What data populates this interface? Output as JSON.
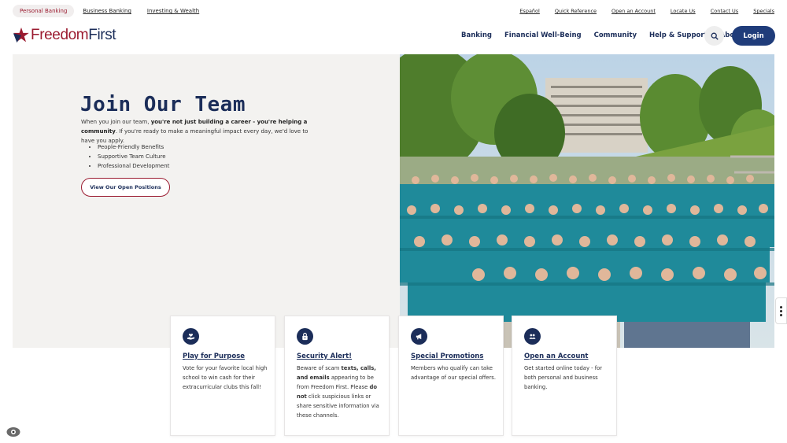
{
  "utility": {
    "tabs": [
      "Personal Banking",
      "Business Banking",
      "Investing & Wealth"
    ],
    "links": [
      "Español",
      "Quick Reference",
      "Open an Account",
      "Locate Us",
      "Contact Us",
      "Specials"
    ]
  },
  "header": {
    "logo_part1": "Freedom",
    "logo_part2": "First",
    "nav": [
      "Banking",
      "Financial Well-Being",
      "Community",
      "Help & Support",
      "About Us"
    ],
    "login_label": "Login"
  },
  "hero": {
    "title": "Join Our Team",
    "text_1": "When you join our team, ",
    "text_bold_1": "you're not just building a career - you're helping a community",
    "text_2": ". If you're ready to make a meaningful impact every day, we'd love to have you apply.",
    "bullets": [
      "People-Friendly Benefits",
      "Supportive Team Culture",
      "Professional Development"
    ],
    "cta_label": "View Our Open Positions"
  },
  "cards": [
    {
      "icon": "hand-heart-icon",
      "title": "Play for Purpose",
      "body": "Vote for your favorite local high school to win cash for their extracurricular clubs this fall!"
    },
    {
      "icon": "lock-icon",
      "title": "Security Alert!",
      "body_a": "Beware of scam ",
      "body_b": "texts, calls, and emails",
      "body_c": " appearing to be from Freedom First. Please ",
      "body_d": "do not",
      "body_e": " click suspicious links or share sensitive information via these channels."
    },
    {
      "icon": "megaphone-icon",
      "title": "Special Promotions",
      "body": "Members who qualify can take advantage of our special offers."
    },
    {
      "icon": "account-icon",
      "title": "Open an Account",
      "body": "Get started online today - for both personal and business banking."
    }
  ],
  "colors": {
    "brand_red": "#9b1b30",
    "brand_navy": "#1b2d59",
    "login_blue": "#1f3c7a",
    "shirt_teal": "#1f8a9a"
  }
}
